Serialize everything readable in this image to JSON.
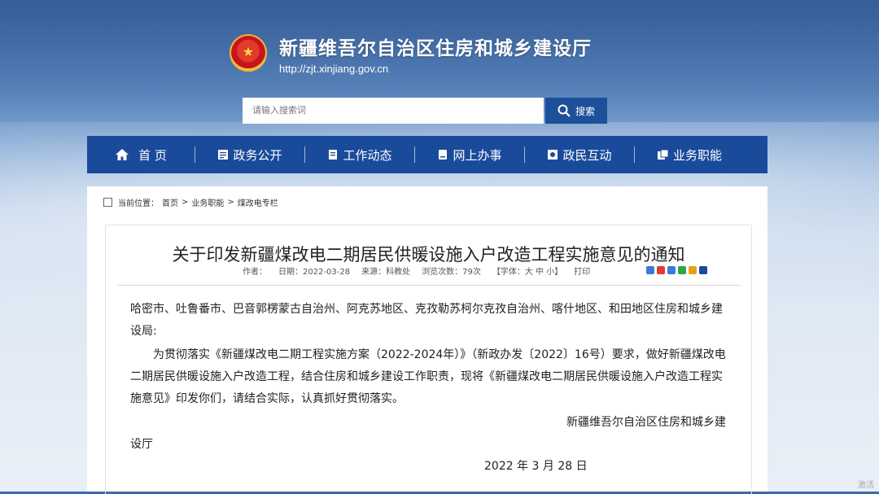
{
  "header": {
    "site_title": "新疆维吾尔自治区住房和城乡建设厅",
    "site_url": "http://zjt.xinjiang.gov.cn"
  },
  "search": {
    "placeholder": "请输入搜索词",
    "button_label": "搜索"
  },
  "nav": {
    "items": [
      {
        "label": "首 页",
        "icon": "home-icon"
      },
      {
        "label": "政务公开",
        "icon": "document-icon"
      },
      {
        "label": "工作动态",
        "icon": "news-icon"
      },
      {
        "label": "网上办事",
        "icon": "service-icon"
      },
      {
        "label": "政民互动",
        "icon": "interaction-icon"
      },
      {
        "label": "业务职能",
        "icon": "function-icon"
      }
    ],
    "background": "#1a4b9b"
  },
  "breadcrumb": {
    "prefix": "当前位置：",
    "items": [
      "首页",
      "业务职能",
      "煤改电专栏"
    ],
    "separator": ">"
  },
  "article": {
    "title": "关于印发新疆煤改电二期居民供暖设施入户改造工程实施意见的通知",
    "meta": {
      "author": "作者：",
      "date": "日期：2022-03-28",
      "source": "来源：科教处",
      "views": "浏览次数：79次",
      "font": "【字体：大 中 小】",
      "print": "打印"
    },
    "addressee": "哈密市、吐鲁番市、巴音郭楞蒙古自治州、阿克苏地区、克孜勒苏柯尔克孜自治州、喀什地区、和田地区住房和城乡建设局:",
    "paragraph": "为贯彻落实《新疆煤改电二期工程实施方案（2022-2024年）》（新政办发〔2022〕16号）要求，做好新疆煤改电二期居民供暖设施入户改造工程，结合住房和城乡建设工作职责，现将《新疆煤改电二期居民供暖设施入户改造工程实施意见》印发你们，请结合实际，认真抓好贯彻落实。",
    "signature_line1": "新疆维吾尔自治区住房和城乡建",
    "signature_line2": "设厅",
    "date": "2022 年 3 月 28 日"
  },
  "watermark": "激活"
}
